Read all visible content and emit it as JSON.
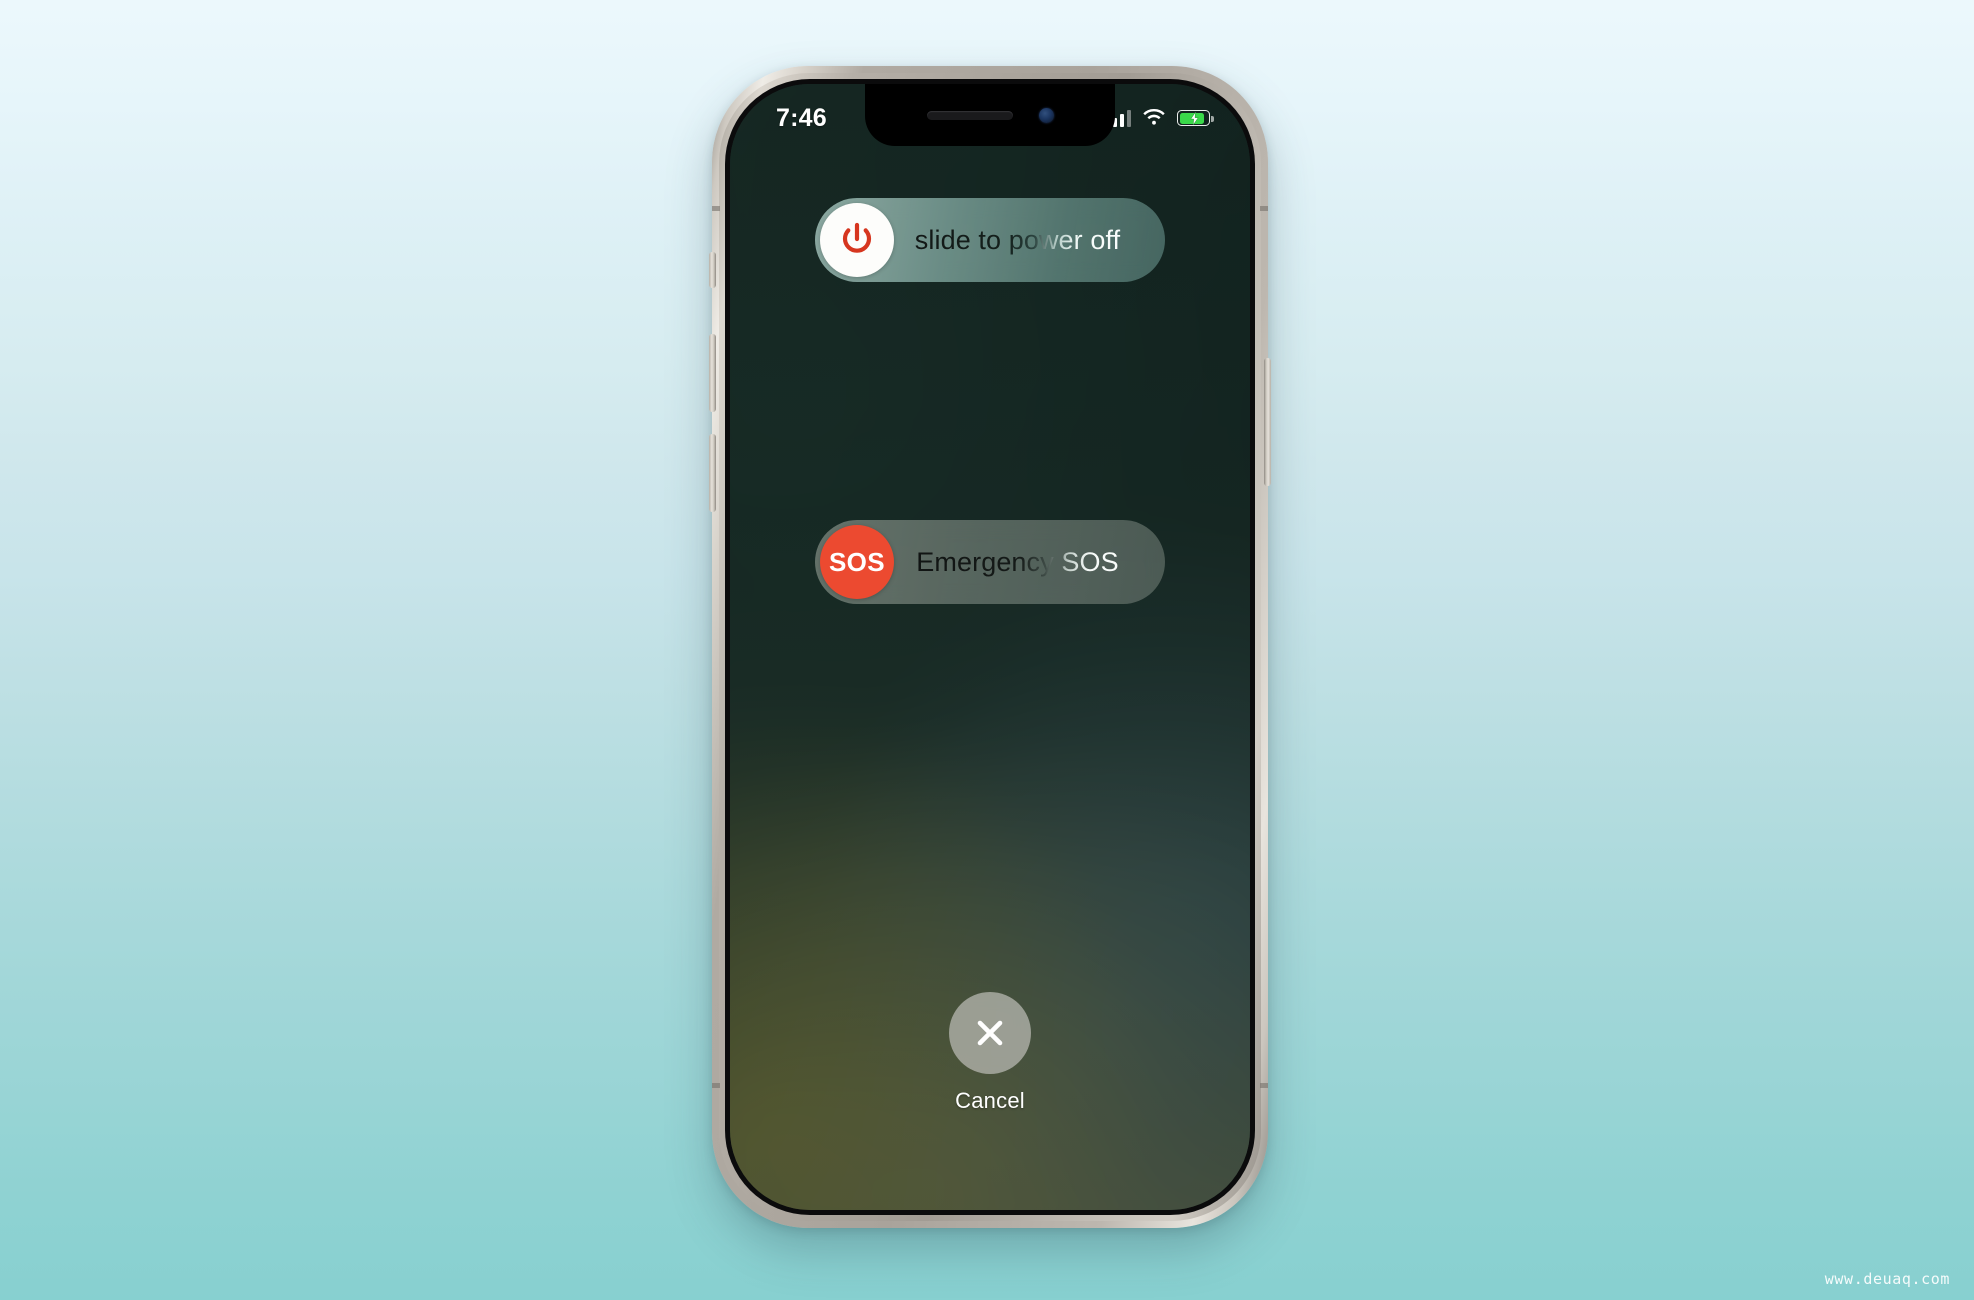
{
  "page": {
    "watermark": "www.deuaq.com",
    "background_top_color": "#ecf8fc",
    "background_bottom_color": "#87d0d0"
  },
  "device": {
    "name": "iphone-x",
    "frame_color": "#b0aaa2",
    "buttons": [
      {
        "name": "mute-switch",
        "label": "Mute switch"
      },
      {
        "name": "volume-up-button",
        "label": "Volume up"
      },
      {
        "name": "volume-down-button",
        "label": "Volume down"
      },
      {
        "name": "power-button",
        "label": "Side / power button"
      }
    ]
  },
  "status_bar": {
    "time": "7:46",
    "signal_bars_filled": 3,
    "signal_bars_total": 4,
    "wifi": "wifi-icon",
    "battery": {
      "icon": "battery-charging-icon",
      "charging": true,
      "fill_percent": 80,
      "fill_color": "#3ad84a",
      "bolt_glyph": "⚡"
    }
  },
  "screen": {
    "wallpaper_description": "blurred dark green gradient",
    "power_off_slider": {
      "label": "slide to power off",
      "knob_icon": "power-icon",
      "knob_background": "#fdfdfb",
      "knob_icon_color": "#d6361f",
      "track_color": "#8cb4ac"
    },
    "emergency_sos_slider": {
      "label": "Emergency SOS",
      "knob_icon": "sos-icon",
      "knob_label": "SOS",
      "knob_background": "#ec4a30",
      "track_color": "#869289"
    },
    "cancel": {
      "label": "Cancel",
      "icon": "close-icon",
      "circle_color": "#b0b2aa"
    }
  }
}
